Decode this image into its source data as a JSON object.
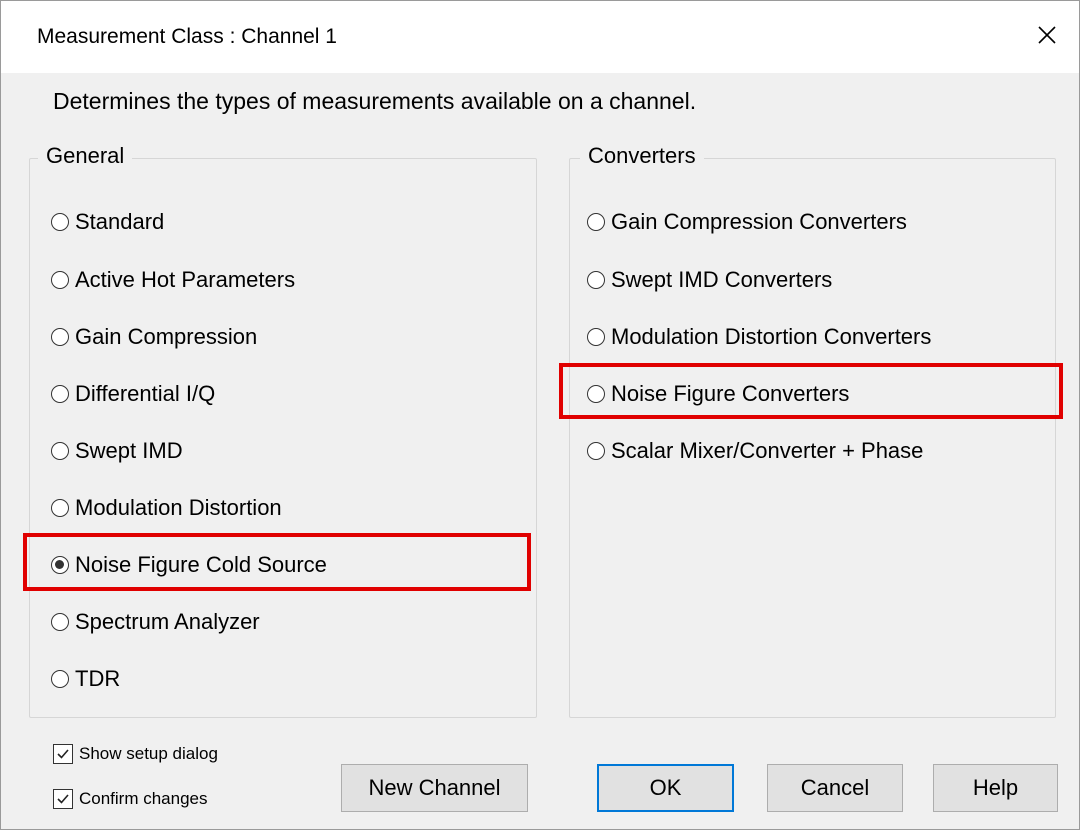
{
  "window": {
    "title": "Measurement Class : Channel 1"
  },
  "description": "Determines the types of measurements available on a channel.",
  "general": {
    "title": "General",
    "options": [
      {
        "label": "Standard",
        "checked": false
      },
      {
        "label": "Active Hot Parameters",
        "checked": false
      },
      {
        "label": "Gain Compression",
        "checked": false
      },
      {
        "label": "Differential I/Q",
        "checked": false
      },
      {
        "label": "Swept IMD",
        "checked": false
      },
      {
        "label": "Modulation Distortion",
        "checked": false
      },
      {
        "label": "Noise Figure Cold Source",
        "checked": true
      },
      {
        "label": "Spectrum Analyzer",
        "checked": false
      },
      {
        "label": "TDR",
        "checked": false
      }
    ]
  },
  "converters": {
    "title": "Converters",
    "options": [
      {
        "label": "Gain Compression Converters",
        "checked": false
      },
      {
        "label": "Swept IMD Converters",
        "checked": false
      },
      {
        "label": "Modulation Distortion Converters",
        "checked": false
      },
      {
        "label": "Noise Figure Converters",
        "checked": false
      },
      {
        "label": "Scalar Mixer/Converter + Phase",
        "checked": false
      }
    ]
  },
  "checkboxes": {
    "show_setup": {
      "label": "Show setup dialog",
      "checked": true
    },
    "confirm_changes": {
      "label": "Confirm changes",
      "checked": true
    }
  },
  "buttons": {
    "new_channel": "New Channel",
    "ok": "OK",
    "cancel": "Cancel",
    "help": "Help"
  },
  "colors": {
    "highlight": "#e00000",
    "default_button_border": "#0078d7"
  }
}
